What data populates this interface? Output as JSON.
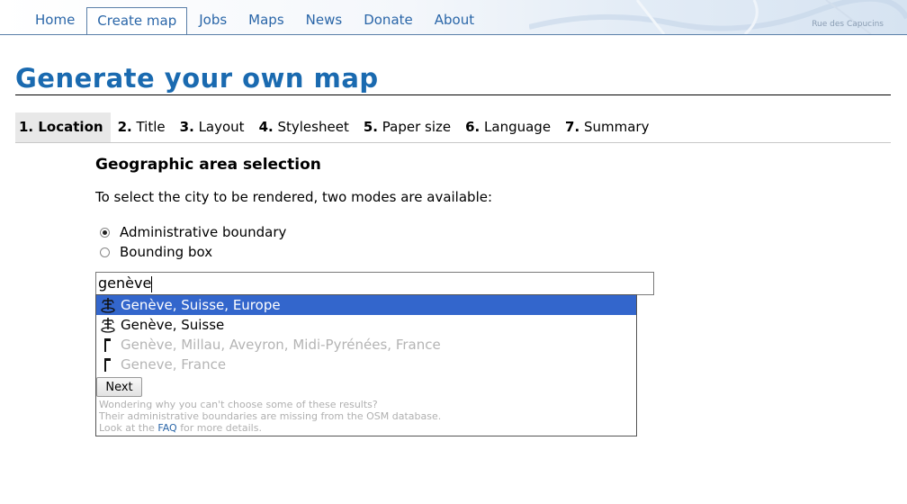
{
  "nav": {
    "items": [
      "Home",
      "Create map",
      "Jobs",
      "Maps",
      "News",
      "Donate",
      "About"
    ],
    "active": "Create map",
    "map_label": "Rue des Capucins"
  },
  "page_title": "Generate your own map",
  "steps": [
    {
      "num": "1.",
      "label": "Location"
    },
    {
      "num": "2.",
      "label": "Title"
    },
    {
      "num": "3.",
      "label": "Layout"
    },
    {
      "num": "4.",
      "label": "Stylesheet"
    },
    {
      "num": "5.",
      "label": "Paper size"
    },
    {
      "num": "6.",
      "label": "Language"
    },
    {
      "num": "7.",
      "label": "Summary"
    }
  ],
  "section": {
    "heading": "Geographic area selection",
    "intro": "To select the city to be rendered, two modes are available:",
    "modes": [
      {
        "label": "Administrative boundary",
        "checked": true
      },
      {
        "label": "Bounding box",
        "checked": false
      }
    ]
  },
  "search": {
    "value": "genève"
  },
  "suggestions": [
    {
      "text": "Genève, Suisse, Europe",
      "icon": "admin-boundary-icon",
      "state": "selected"
    },
    {
      "text": "Genève, Suisse",
      "icon": "admin-boundary-icon",
      "state": "enabled"
    },
    {
      "text": "Genève, Millau, Aveyron, Midi-Pyrénées, France",
      "icon": "flag-icon",
      "state": "disabled"
    },
    {
      "text": "Geneve, France",
      "icon": "flag-icon",
      "state": "disabled"
    }
  ],
  "next_label": "Next",
  "help": {
    "line1": "Wondering why you can't choose some of these results?",
    "line2": "Their administrative boundaries are missing from the OSM database.",
    "line3_before": "Look at the",
    "faq_link": "FAQ",
    "line3_after": "for more details."
  },
  "colors": {
    "accent": "#1a6ab0",
    "link": "#2a66a8",
    "selection": "#3366cc",
    "disabled": "#b4b4b4"
  }
}
